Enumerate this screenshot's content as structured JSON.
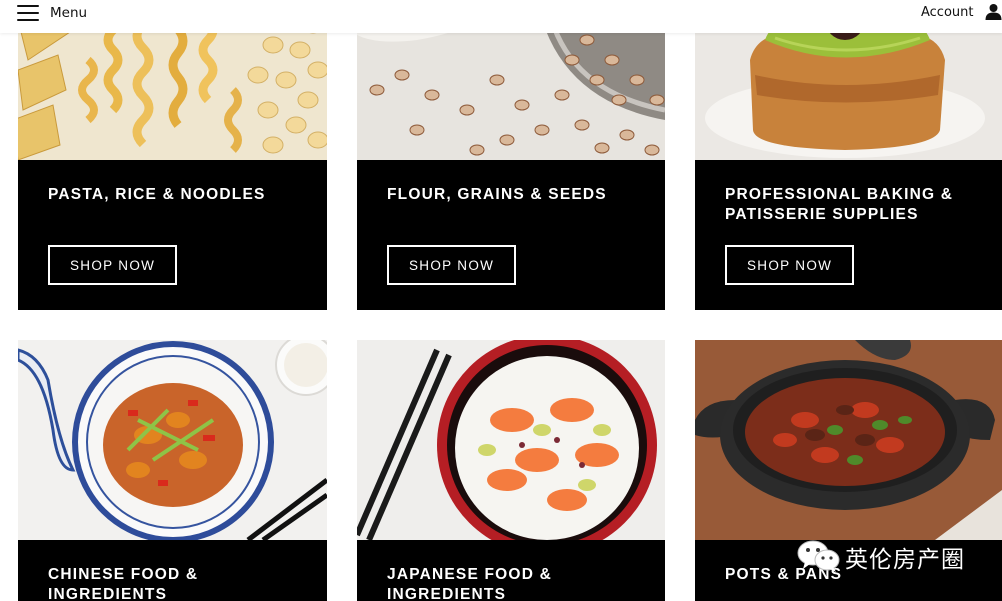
{
  "header": {
    "menu_label": "Menu",
    "account_label": "Account"
  },
  "tiles": [
    {
      "title": "PASTA, RICE & NOODLES",
      "button": "SHOP NOW"
    },
    {
      "title": "FLOUR, GRAINS & SEEDS",
      "button": "SHOP NOW"
    },
    {
      "title": "PROFESSIONAL BAKING & PATISSERIE SUPPLIES",
      "button": "SHOP NOW"
    },
    {
      "title": "CHINESE FOOD & INGREDIENTS"
    },
    {
      "title": "JAPANESE FOOD & INGREDIENTS"
    },
    {
      "title": "POTS & PANS"
    }
  ],
  "watermark": {
    "text": "英伦房产圈"
  },
  "colors": {
    "panel": "#000000",
    "text": "#ffffff",
    "header_bg": "#ffffff"
  }
}
